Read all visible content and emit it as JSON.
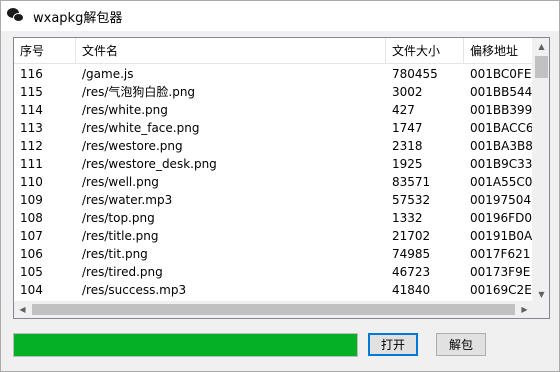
{
  "window": {
    "title": "wxapkg解包器"
  },
  "table": {
    "columns": [
      "序号",
      "文件名",
      "文件大小",
      "偏移地址"
    ],
    "rows": [
      [
        "116",
        "/game.js",
        "780455",
        "001BC0FE"
      ],
      [
        "115",
        "/res/气泡狗白脸.png",
        "3002",
        "001BB544"
      ],
      [
        "114",
        "/res/white.png",
        "427",
        "001BB399"
      ],
      [
        "113",
        "/res/white_face.png",
        "1747",
        "001BACC6"
      ],
      [
        "112",
        "/res/westore.png",
        "2318",
        "001BA3B8"
      ],
      [
        "111",
        "/res/westore_desk.png",
        "1925",
        "001B9C33"
      ],
      [
        "110",
        "/res/well.png",
        "83571",
        "001A55C0"
      ],
      [
        "109",
        "/res/water.mp3",
        "57532",
        "00197504"
      ],
      [
        "108",
        "/res/top.png",
        "1332",
        "00196FD0"
      ],
      [
        "107",
        "/res/title.png",
        "21702",
        "00191B0A"
      ],
      [
        "106",
        "/res/tit.png",
        "74985",
        "0017F621"
      ],
      [
        "105",
        "/res/tired.png",
        "46723",
        "00173F9E"
      ],
      [
        "104",
        "/res/success.mp3",
        "41840",
        "00169C2E"
      ]
    ]
  },
  "progress": {
    "value": 1.0,
    "color": "#06b025"
  },
  "buttons": {
    "open": "打开",
    "unpack": "解包"
  },
  "icons": {
    "app": "wechat-icon",
    "scroll_up": "up-arrow-icon",
    "scroll_down": "down-arrow-icon",
    "scroll_left": "left-arrow-icon",
    "scroll_right": "right-arrow-icon"
  }
}
